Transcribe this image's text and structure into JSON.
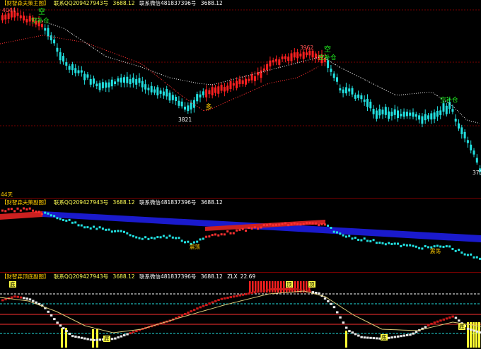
{
  "main_pane": {
    "title": "【财智森夫策主图】",
    "qq_text": "联系QQ2094279​43号",
    "price_a": "3688.12",
    "wx_text": "联系微信481837396号",
    "price_b": "3688.12",
    "left_price": "4044",
    "high_label": "3962",
    "low_label": "3821",
    "right_label": "370",
    "signal_kong": "空",
    "signal_kongbucang": "空补仓",
    "signal_duo": "多",
    "colors": {
      "up": "#ff2020",
      "down": "#22e0e0",
      "stop_up": "#ff3030",
      "stop_down": "#e0e0e0",
      "grid": "#7a0000",
      "signal": "#22ff22",
      "duo": "#ffcc00"
    }
  },
  "divider_label": "44天",
  "sub_pane_1": {
    "title": "【财智森夫策副图】",
    "qq_text": "联系QQ209427943号",
    "price_a": "3688.12",
    "wx_text": "联系微信481837396号",
    "price_b": "3688.12",
    "label_zhendang_1": "震荡",
    "label_zhendang_2": "震荡"
  },
  "sub_pane_2": {
    "title": "【财智森顶底副图】",
    "qq_text": "联系QQ209427943号",
    "price_a": "3688.12",
    "wx_text": "联系微信481837396号",
    "price_b": "3688.12",
    "zlx_label": "ZLX",
    "zlx_value": "22.69",
    "marker_di": "底",
    "marker_ding": "顶"
  }
}
